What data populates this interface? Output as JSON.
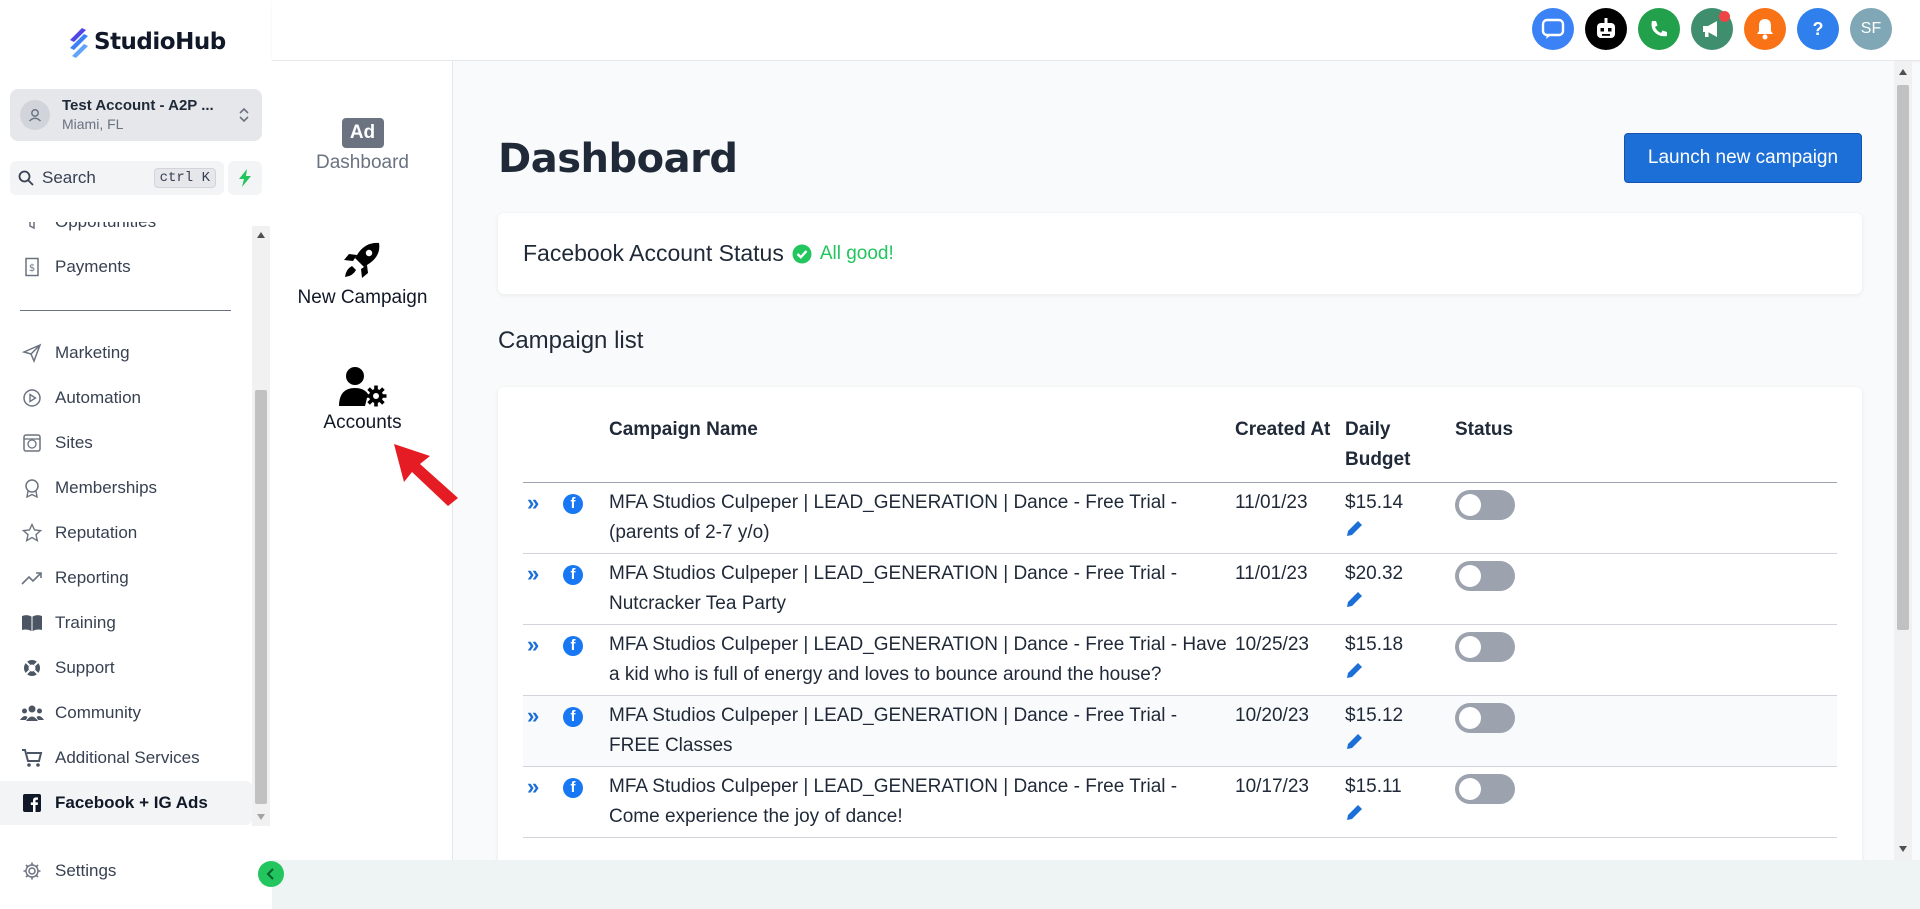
{
  "app": {
    "name": "StudioHub"
  },
  "account": {
    "name": "Test Account - A2P ...",
    "location": "Miami, FL"
  },
  "search": {
    "label": "Search",
    "shortcut": "ctrl K"
  },
  "sidebar": {
    "items": [
      {
        "label": "Opportunities",
        "icon": "funnel-icon"
      },
      {
        "label": "Payments",
        "icon": "invoice-icon"
      },
      {
        "label": "Marketing",
        "icon": "send-icon"
      },
      {
        "label": "Automation",
        "icon": "automation-icon"
      },
      {
        "label": "Sites",
        "icon": "globe-icon"
      },
      {
        "label": "Memberships",
        "icon": "badge-icon"
      },
      {
        "label": "Reputation",
        "icon": "star-icon"
      },
      {
        "label": "Reporting",
        "icon": "trend-icon"
      },
      {
        "label": "Training",
        "icon": "book-icon"
      },
      {
        "label": "Support",
        "icon": "lifebuoy-icon"
      },
      {
        "label": "Community",
        "icon": "users-icon"
      },
      {
        "label": "Additional Services",
        "icon": "cart-icon"
      },
      {
        "label": "Facebook + IG Ads",
        "icon": "facebook-icon"
      }
    ],
    "active": "Facebook + IG Ads",
    "settings_label": "Settings"
  },
  "topbar": {
    "avatar_initials": "SF",
    "help_label": "?",
    "icons": [
      {
        "name": "chat-icon",
        "color": "#3b82f6"
      },
      {
        "name": "robot-icon",
        "color": "#000000"
      },
      {
        "name": "phone-icon",
        "color": "#22a04b"
      },
      {
        "name": "megaphone-icon",
        "color": "#3f8f6e"
      },
      {
        "name": "bell-icon",
        "color": "#f97316"
      },
      {
        "name": "help-icon",
        "color": "#2f80ed"
      },
      {
        "name": "avatar",
        "color": "#7fa7b5"
      }
    ]
  },
  "subnav": {
    "ad_badge": "Ad",
    "items": [
      {
        "label": "Dashboard"
      },
      {
        "label": "New Campaign"
      },
      {
        "label": "Accounts"
      }
    ]
  },
  "main": {
    "title": "Dashboard",
    "launch_label": "Launch new campaign",
    "status": {
      "label": "Facebook Account Status",
      "value": "All good!"
    },
    "list_title": "Campaign list",
    "table": {
      "headers": {
        "name": "Campaign Name",
        "created": "Created At",
        "budget": "Daily Budget",
        "status": "Status"
      },
      "rows": [
        {
          "name": "MFA Studios Culpeper | LEAD_GENERATION | Dance - Free Trial - (parents of 2-7 y/o)",
          "created": "11/01/23",
          "budget": "$15.14",
          "active": false
        },
        {
          "name": "MFA Studios Culpeper | LEAD_GENERATION | Dance - Free Trial - Nutcracker Tea Party",
          "created": "11/01/23",
          "budget": "$20.32",
          "active": false
        },
        {
          "name": "MFA Studios Culpeper | LEAD_GENERATION | Dance - Free Trial - Have a kid who is full of energy and loves to bounce around the house?",
          "created": "10/25/23",
          "budget": "$15.18",
          "active": false
        },
        {
          "name": "MFA Studios Culpeper | LEAD_GENERATION | Dance - Free Trial - FREE Classes",
          "created": "10/20/23",
          "budget": "$15.12",
          "active": false
        },
        {
          "name": "MFA Studios Culpeper | LEAD_GENERATION | Dance - Free Trial - Come experience the joy of dance!",
          "created": "10/17/23",
          "budget": "$15.11",
          "active": false
        }
      ]
    }
  },
  "colors": {
    "accent": "#1d6fd8",
    "success": "#22c55e",
    "facebook": "#1877f2"
  }
}
